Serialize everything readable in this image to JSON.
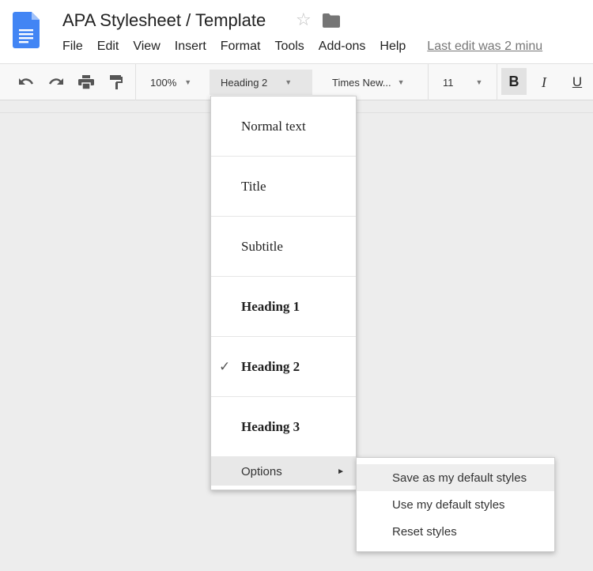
{
  "header": {
    "title": "APA Stylesheet / Template",
    "menus": [
      "File",
      "Edit",
      "View",
      "Insert",
      "Format",
      "Tools",
      "Add-ons",
      "Help"
    ],
    "last_edit": "Last edit was 2 minu"
  },
  "toolbar": {
    "zoom": "100%",
    "style": "Heading 2",
    "font": "Times New...",
    "font_size": "11",
    "bold": "B",
    "italic": "I",
    "underline": "U",
    "icons": [
      "undo-icon",
      "redo-icon",
      "print-icon",
      "paint-format-icon"
    ]
  },
  "style_menu": {
    "items": [
      {
        "label": "Normal text",
        "bold": false,
        "checked": false
      },
      {
        "label": "Title",
        "bold": false,
        "checked": false
      },
      {
        "label": "Subtitle",
        "bold": false,
        "checked": false
      },
      {
        "label": "Heading 1",
        "bold": true,
        "checked": false
      },
      {
        "label": "Heading 2",
        "bold": true,
        "checked": true
      },
      {
        "label": "Heading 3",
        "bold": true,
        "checked": false
      }
    ],
    "check_mark": "✓",
    "options_label": "Options",
    "options_arrow": "►"
  },
  "options_submenu": {
    "items": [
      "Save as my default styles",
      "Use my default styles",
      "Reset styles"
    ],
    "highlighted": 0
  },
  "colors": {
    "doc_blue": "#4285f4",
    "toolbar_bg": "#f8f8f8",
    "canvas_bg": "#ededed"
  }
}
